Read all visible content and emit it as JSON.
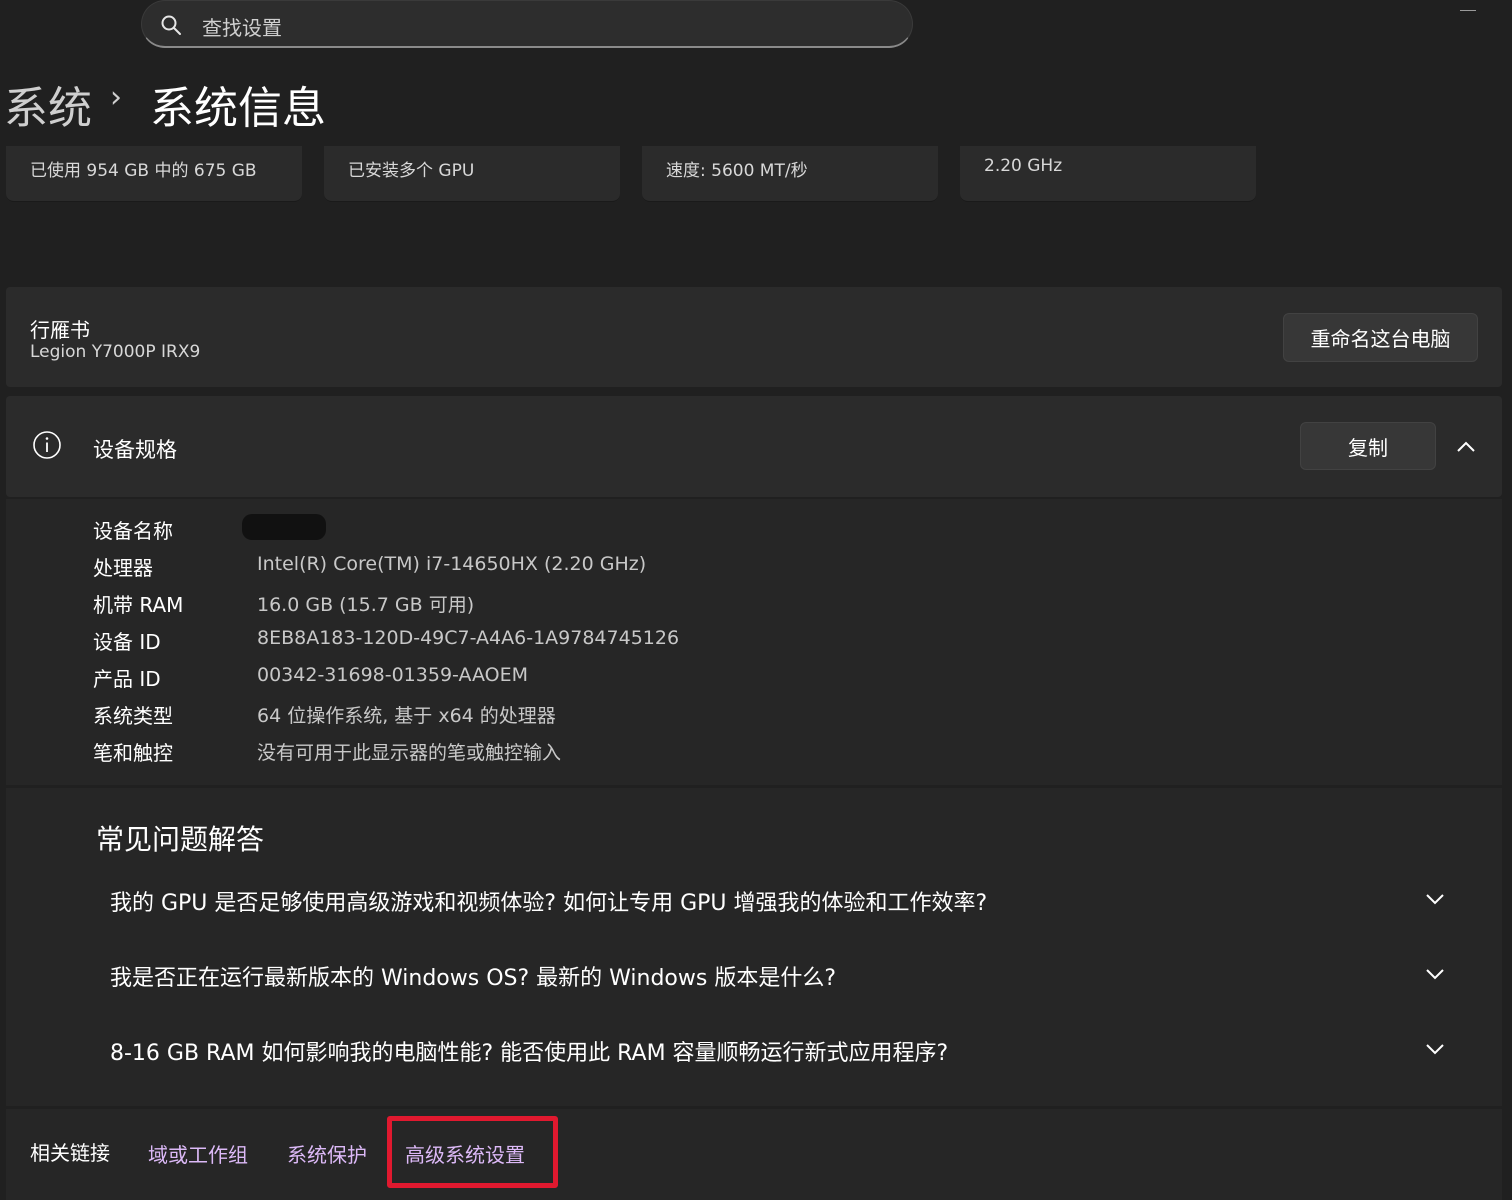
{
  "search": {
    "placeholder": "查找设置"
  },
  "breadcrumb": {
    "parent": "系统",
    "separator": "›",
    "current": "系统信息"
  },
  "stat_cards": [
    {
      "text": "已使用 954 GB 中的 675 GB"
    },
    {
      "text": "已安装多个 GPU"
    },
    {
      "text": "速度: 5600 MT/秒"
    },
    {
      "text": "2.20 GHz"
    }
  ],
  "pc": {
    "name": "行雁书",
    "model": "Legion Y7000P IRX9",
    "rename_label": "重命名这台电脑"
  },
  "specs": {
    "title": "设备规格",
    "copy_label": "复制",
    "rows": [
      {
        "label": "设备名称",
        "value": ""
      },
      {
        "label": "处理器",
        "value": "Intel(R) Core(TM) i7-14650HX (2.20 GHz)"
      },
      {
        "label": "机带 RAM",
        "value": "16.0 GB (15.7 GB 可用)"
      },
      {
        "label": "设备 ID",
        "value": "8EB8A183-120D-49C7-A4A6-1A9784745126"
      },
      {
        "label": "产品 ID",
        "value": "00342-31698-01359-AAOEM"
      },
      {
        "label": "系统类型",
        "value": "64 位操作系统, 基于 x64 的处理器"
      },
      {
        "label": "笔和触控",
        "value": "没有可用于此显示器的笔或触控输入"
      }
    ]
  },
  "faq": {
    "title": "常见问题解答",
    "questions": [
      "我的 GPU 是否足够使用高级游戏和视频体验? 如何让专用 GPU 增强我的体验和工作效率?",
      "我是否正在运行最新版本的 Windows OS? 最新的 Windows 版本是什么?",
      "8-16 GB RAM 如何影响我的电脑性能? 能否使用此 RAM 容量顺畅运行新式应用程序?"
    ]
  },
  "related": {
    "label": "相关链接",
    "links": [
      "域或工作组",
      "系统保护",
      "高级系统设置"
    ]
  },
  "colors": {
    "background": "#202020",
    "card": "#2b2b2b",
    "link": "#dcb9f7",
    "highlight": "#e0192f"
  }
}
